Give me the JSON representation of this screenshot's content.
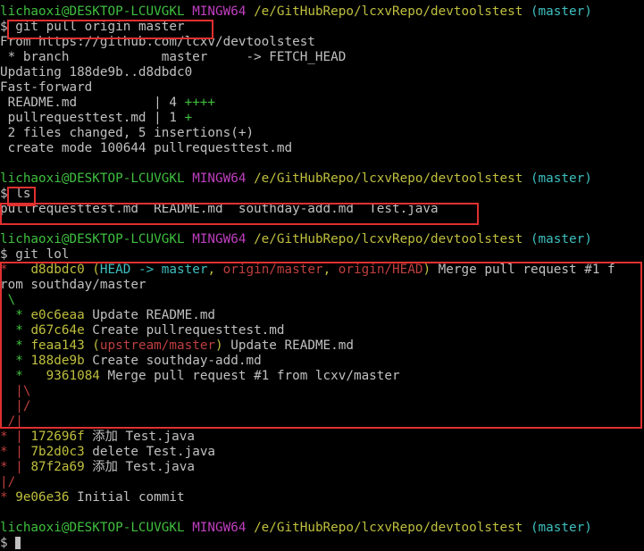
{
  "colors": {
    "background": "#000000",
    "default_text": "#c0c0c0",
    "user_host": "#3fbf3f",
    "env": "#bf3fbf",
    "path": "#bfbf3f",
    "branch": "#3fbfbf",
    "ref_red": "#bf3f3f",
    "highlight_box": "#e03030"
  },
  "prompt": {
    "user_host": "lichaoxi@DESKTOP-LCUVGKL",
    "env": "MINGW64",
    "path": "/e/GitHubRepo/lcxvRepo/devtoolstest",
    "branch": "(master)",
    "symbol": "$"
  },
  "block1": {
    "command": "git pull origin master",
    "output": [
      "From https://github.com/lcxv/devtoolstest",
      " * branch            master     -> FETCH_HEAD",
      "Updating 188de9b..d8dbdc0",
      "Fast-forward"
    ],
    "stat_file1": " README.md          | 4 ",
    "stat_file1_plus": "++++",
    "stat_file2": " pullrequesttest.md | 1 ",
    "stat_file2_plus": "+",
    "summary": [
      " 2 files changed, 5 insertions(+)",
      " create mode 100644 pullrequesttest.md"
    ]
  },
  "block2": {
    "command": "ls",
    "output": "pullrequesttest.md  README.md  southday-add.md  Test.java"
  },
  "block3": {
    "command": "git lol",
    "l1_graph": "*   ",
    "l1_hash": "d8dbdc0",
    "l1_open": " (",
    "l1_head": "HEAD -> master",
    "l1_sep1": ", ",
    "l1_origin_master": "origin/master",
    "l1_sep2": ", ",
    "l1_origin_head": "origin/HEAD",
    "l1_close": ")",
    "l1_msg": " Merge pull request #1 f",
    "l2_text": "rom southday/master",
    "l3_graph": " \\",
    "l4_graph": "  * ",
    "l4_hash": "e0c6eaa",
    "l4_msg": " Update README.md",
    "l5_graph": "  * ",
    "l5_hash": "d67c64e",
    "l5_msg": " Create pullrequesttest.md",
    "l6_graph": "  * ",
    "l6_hash": "feaa143",
    "l6_open": " (",
    "l6_ref": "upstream/master",
    "l6_close": ")",
    "l6_msg": " Update README.md",
    "l7_graph": "  * ",
    "l7_hash": "188de9b",
    "l7_msg": " Create southday-add.md",
    "l8_graph": "  *   ",
    "l8_hash": "9361084",
    "l8_msg": " Merge pull request #1 from lcxv/master",
    "l9_graph": "  |\\",
    "l10_graph": "  |/",
    "l11_graph": " /|",
    "l12_graph": "* | ",
    "l12_hash": "172696f",
    "l12_msg": " 添加 Test.java",
    "l13_graph": "* | ",
    "l13_hash": "7b2d0c3",
    "l13_msg": " delete Test.java",
    "l14_graph": "* | ",
    "l14_hash": "87f2a69",
    "l14_msg": " 添加 Test.java",
    "l15_graph": "|/",
    "l16_graph": "* ",
    "l16_hash": "9e06e36",
    "l16_msg": " Initial commit"
  }
}
